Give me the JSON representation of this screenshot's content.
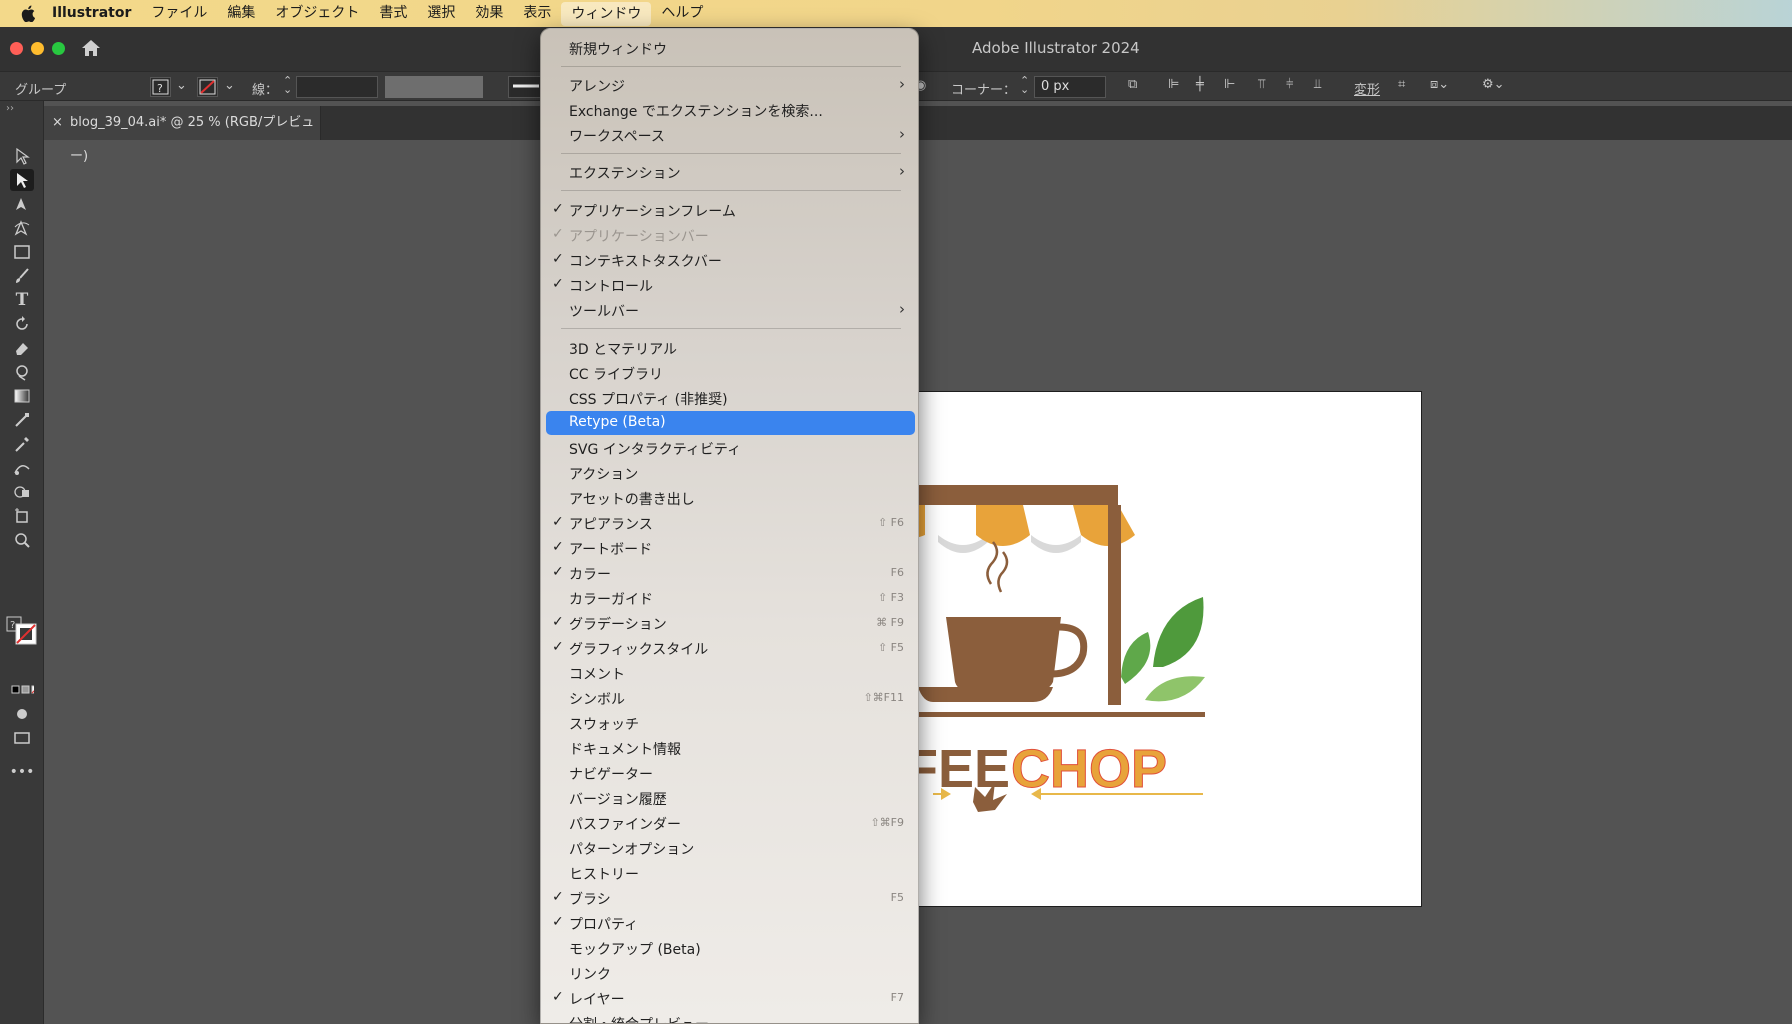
{
  "menubar": {
    "items": [
      "Illustrator",
      "ファイル",
      "編集",
      "オブジェクト",
      "書式",
      "選択",
      "効果",
      "表示",
      "ウィンドウ",
      "ヘルプ"
    ]
  },
  "window": {
    "title": "Adobe Illustrator 2024"
  },
  "control": {
    "group_label": "グループ",
    "stroke_label": "線：",
    "corner_label": "コーナー：",
    "corner_value": "0 px",
    "transform_label": "変形"
  },
  "tab": {
    "close": "×",
    "title": "blog_39_04.ai* @ 25 % (RGB/プレビュー)"
  },
  "artwork": {
    "text_left": "FEE",
    "text_right": "CHOP"
  },
  "menu": {
    "items": [
      {
        "label": "新規ウィンドウ",
        "checked": false,
        "submenu": false,
        "shortcut": "",
        "disabled": false
      },
      {
        "sep": true
      },
      {
        "label": "アレンジ",
        "checked": false,
        "submenu": true,
        "shortcut": "",
        "disabled": false
      },
      {
        "label": "Exchange でエクステンションを検索...",
        "checked": false,
        "submenu": false,
        "shortcut": "",
        "disabled": false
      },
      {
        "label": "ワークスペース",
        "checked": false,
        "submenu": true,
        "shortcut": "",
        "disabled": false
      },
      {
        "sep": true
      },
      {
        "label": "エクステンション",
        "checked": false,
        "submenu": true,
        "shortcut": "",
        "disabled": false
      },
      {
        "sep": true
      },
      {
        "label": "アプリケーションフレーム",
        "checked": true,
        "submenu": false,
        "shortcut": "",
        "disabled": false
      },
      {
        "label": "アプリケーションバー",
        "checked": true,
        "submenu": false,
        "shortcut": "",
        "disabled": true
      },
      {
        "label": "コンテキストタスクバー",
        "checked": true,
        "submenu": false,
        "shortcut": "",
        "disabled": false
      },
      {
        "label": "コントロール",
        "checked": true,
        "submenu": false,
        "shortcut": "",
        "disabled": false
      },
      {
        "label": "ツールバー",
        "checked": false,
        "submenu": true,
        "shortcut": "",
        "disabled": false
      },
      {
        "sep": true
      },
      {
        "label": "3D とマテリアル",
        "checked": false,
        "submenu": false,
        "shortcut": "",
        "disabled": false
      },
      {
        "label": "CC ライブラリ",
        "checked": false,
        "submenu": false,
        "shortcut": "",
        "disabled": false
      },
      {
        "label": "CSS プロパティ (非推奨)",
        "checked": false,
        "submenu": false,
        "shortcut": "",
        "disabled": false
      },
      {
        "label": "Retype (Beta)",
        "checked": false,
        "submenu": false,
        "shortcut": "",
        "disabled": false,
        "highlighted": true
      },
      {
        "label": "SVG インタラクティビティ",
        "checked": false,
        "submenu": false,
        "shortcut": "",
        "disabled": false
      },
      {
        "label": "アクション",
        "checked": false,
        "submenu": false,
        "shortcut": "",
        "disabled": false
      },
      {
        "label": "アセットの書き出し",
        "checked": false,
        "submenu": false,
        "shortcut": "",
        "disabled": false
      },
      {
        "label": "アピアランス",
        "checked": true,
        "submenu": false,
        "shortcut": "⇧ F6",
        "disabled": false
      },
      {
        "label": "アートボード",
        "checked": true,
        "submenu": false,
        "shortcut": "",
        "disabled": false
      },
      {
        "label": "カラー",
        "checked": true,
        "submenu": false,
        "shortcut": "F6",
        "disabled": false
      },
      {
        "label": "カラーガイド",
        "checked": false,
        "submenu": false,
        "shortcut": "⇧ F3",
        "disabled": false
      },
      {
        "label": "グラデーション",
        "checked": true,
        "submenu": false,
        "shortcut": "⌘ F9",
        "disabled": false
      },
      {
        "label": "グラフィックスタイル",
        "checked": true,
        "submenu": false,
        "shortcut": "⇧ F5",
        "disabled": false
      },
      {
        "label": "コメント",
        "checked": false,
        "submenu": false,
        "shortcut": "",
        "disabled": false
      },
      {
        "label": "シンボル",
        "checked": false,
        "submenu": false,
        "shortcut": "⇧⌘F11",
        "disabled": false
      },
      {
        "label": "スウォッチ",
        "checked": false,
        "submenu": false,
        "shortcut": "",
        "disabled": false
      },
      {
        "label": "ドキュメント情報",
        "checked": false,
        "submenu": false,
        "shortcut": "",
        "disabled": false
      },
      {
        "label": "ナビゲーター",
        "checked": false,
        "submenu": false,
        "shortcut": "",
        "disabled": false
      },
      {
        "label": "バージョン履歴",
        "checked": false,
        "submenu": false,
        "shortcut": "",
        "disabled": false
      },
      {
        "label": "パスファインダー",
        "checked": false,
        "submenu": false,
        "shortcut": "⇧⌘F9",
        "disabled": false
      },
      {
        "label": "パターンオプション",
        "checked": false,
        "submenu": false,
        "shortcut": "",
        "disabled": false
      },
      {
        "label": "ヒストリー",
        "checked": false,
        "submenu": false,
        "shortcut": "",
        "disabled": false
      },
      {
        "label": "ブラシ",
        "checked": true,
        "submenu": false,
        "shortcut": "F5",
        "disabled": false
      },
      {
        "label": "プロパティ",
        "checked": true,
        "submenu": false,
        "shortcut": "",
        "disabled": false
      },
      {
        "label": "モックアップ (Beta)",
        "checked": false,
        "submenu": false,
        "shortcut": "",
        "disabled": false
      },
      {
        "label": "リンク",
        "checked": false,
        "submenu": false,
        "shortcut": "",
        "disabled": false
      },
      {
        "label": "レイヤー",
        "checked": true,
        "submenu": false,
        "shortcut": "F7",
        "disabled": false
      },
      {
        "label": "分割・統合プレビュー",
        "checked": false,
        "submenu": false,
        "shortcut": "",
        "disabled": false
      }
    ]
  },
  "colors": {
    "highlight": "#3a84ee",
    "brown": "#8b5e3c",
    "orange": "#e8a33a",
    "green": "#5fa84a"
  }
}
